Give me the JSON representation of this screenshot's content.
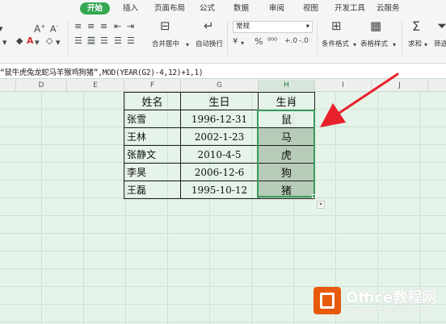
{
  "tabs": [
    {
      "label": "开始",
      "active": true
    },
    {
      "label": "插入"
    },
    {
      "label": "页面布局"
    },
    {
      "label": "公式"
    },
    {
      "label": "数据"
    },
    {
      "label": "审阅"
    },
    {
      "label": "视图"
    },
    {
      "label": "开发工具"
    },
    {
      "label": "云服务"
    }
  ],
  "toolbar": {
    "merge_center": "合并居中",
    "auto_wrap": "自动换行",
    "number_format": "常规",
    "conditional_format": "条件格式",
    "table_style": "表格样式",
    "sum": "求和",
    "filter": "筛选",
    "font_color_label": "A"
  },
  "formula": "“鼠牛虎兔龙蛇马羊猴鸡狗猪”,MOD(YEAR(G2)-4,12)+1,1)",
  "columns": [
    "D",
    "E",
    "F",
    "G",
    "H",
    "I",
    "J"
  ],
  "selected_column": "H",
  "table": {
    "headers": [
      "姓名",
      "生日",
      "生肖"
    ],
    "rows": [
      [
        "张雪",
        "1996-12-31",
        "鼠"
      ],
      [
        "王林",
        "2002-1-23",
        "马"
      ],
      [
        "张静文",
        "2010-4-5",
        "虎"
      ],
      [
        "李昊",
        "2006-12-6",
        "狗"
      ],
      [
        "王磊",
        "1995-10-12",
        "猪"
      ]
    ]
  },
  "watermark": {
    "title": "Office教程网",
    "url": "www.office26.com"
  },
  "colors": {
    "accent": "#34a853",
    "arrow": "#e8212a",
    "selection": "#3a9a5a"
  }
}
